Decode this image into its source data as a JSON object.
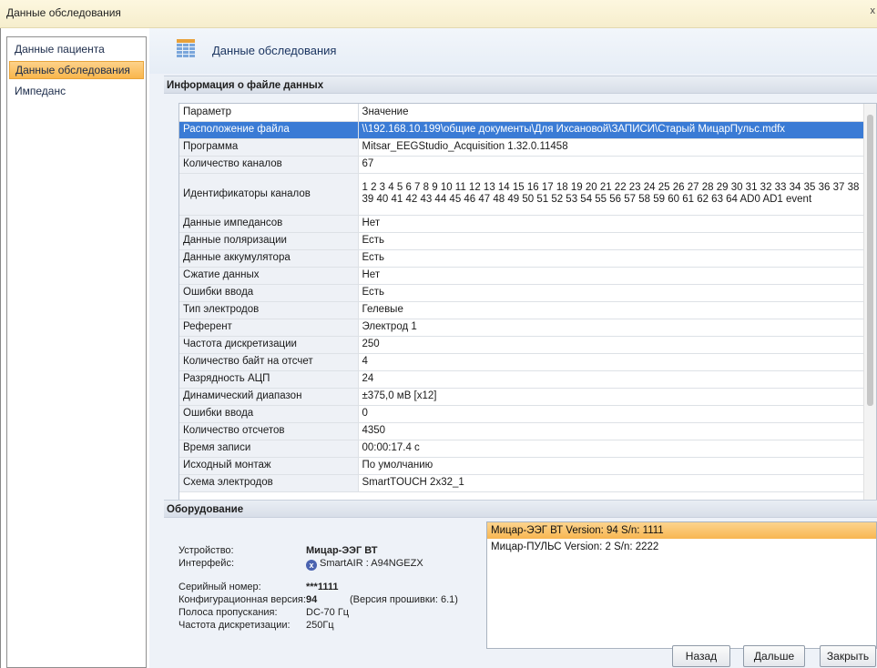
{
  "window": {
    "title": "Данные обследования",
    "close_glyph": "x"
  },
  "sidebar": {
    "items": [
      {
        "label": "Данные пациента"
      },
      {
        "label": "Данные обследования"
      },
      {
        "label": "Импеданс"
      }
    ],
    "active_index": 1
  },
  "header": {
    "title": "Данные обследования",
    "icon": "table-icon"
  },
  "file_info": {
    "section_title": "Информация о файле данных",
    "columns": [
      "Параметр",
      "Значение"
    ],
    "rows": [
      [
        "Расположение файла",
        "\\\\192.168.10.199\\общие документы\\Для Ихсановой\\ЗАПИСИ\\Старый МицарПульс.mdfx"
      ],
      [
        "Программа",
        "Mitsar_EEGStudio_Acquisition 1.32.0.11458"
      ],
      [
        "Количество каналов",
        "67"
      ],
      [
        "Идентификаторы каналов",
        "1 2 3 4 5 6 7 8 9 10 11 12 13 14 15 16 17 18 19 20 21 22 23 24 25 26 27 28 29 30 31 32 33 34 35 36 37 38 39 40 41 42 43 44 45 46 47 48 49 50 51 52 53 54 55 56 57 58 59 60 61 62 63 64 AD0 AD1 event"
      ],
      [
        "Данные импедансов",
        "Нет"
      ],
      [
        "Данные поляризации",
        "Есть"
      ],
      [
        "Данные аккумулятора",
        "Есть"
      ],
      [
        "Сжатие данных",
        "Нет"
      ],
      [
        "Ошибки ввода",
        "Есть"
      ],
      [
        "Тип электродов",
        "Гелевые"
      ],
      [
        "Референт",
        "Электрод 1"
      ],
      [
        "Частота дискретизации",
        "250"
      ],
      [
        "Количество байт на отсчет",
        "4"
      ],
      [
        "Разрядность АЦП",
        "24"
      ],
      [
        "Динамический диапазон",
        "±375,0 мВ [x12]"
      ],
      [
        "Ошибки ввода",
        "0"
      ],
      [
        "Количество отсчетов",
        "4350"
      ],
      [
        "Время записи",
        "00:00:17.4 с"
      ],
      [
        "Исходный монтаж",
        "По умолчанию"
      ],
      [
        "Схема электродов",
        "SmartTOUCH 2x32_1"
      ]
    ],
    "selected_row": 0,
    "tall_row": 3
  },
  "equipment": {
    "section_title": "Оборудование",
    "device_label": "Устройство:",
    "device_value": "Мицар-ЭЭГ ВТ",
    "interface_label": "Интерфейс:",
    "interface_value": "SmartAIR : A94NGEZX",
    "interface_icon": "bluetooth-x-icon",
    "serial_label": "Серийный номер:",
    "serial_value": "***1111",
    "config_label": "Конфигурационная версия:",
    "config_value": "94",
    "firmware_note": "(Версия прошивки: 6.1)",
    "bandwidth_label": "Полоса пропускания:",
    "bandwidth_value": "DC-70 Гц",
    "sampling_label": "Частота дискретизации:",
    "sampling_value": "250Гц",
    "devices": [
      "Мицар-ЭЭГ ВТ Version: 94 S/n: 1111",
      "Мицар-ПУЛЬС Version: 2 S/n: 2222"
    ],
    "selected_device": 0
  },
  "buttons": {
    "back": "Назад",
    "next": "Дальше",
    "close": "Закрыть"
  }
}
